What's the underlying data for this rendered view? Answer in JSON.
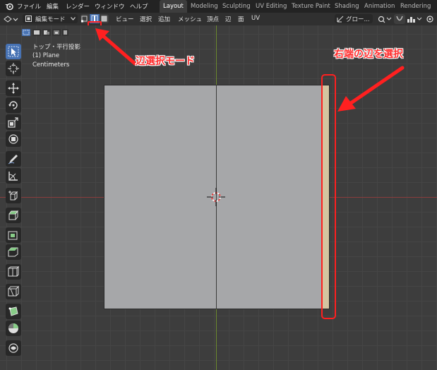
{
  "menubar": {
    "items": [
      "ファイル",
      "編集",
      "レンダー",
      "ウィンドウ",
      "ヘルプ"
    ],
    "workspaces": [
      "Layout",
      "Modeling",
      "Sculpting",
      "UV Editing",
      "Texture Paint",
      "Shading",
      "Animation",
      "Rendering"
    ],
    "active_workspace": "Layout"
  },
  "header": {
    "mode_label": "編集モード",
    "menus": [
      "ビュー",
      "選択",
      "追加",
      "メッシュ",
      "頂点",
      "辺",
      "面",
      "UV"
    ],
    "orientation_label": "グロー..."
  },
  "viewport": {
    "view_name": "トップ・平行投影",
    "object_name": "(1) Plane",
    "units": "Centimeters"
  },
  "annotations": {
    "edge_mode_label": "辺選択モード",
    "select_right_edge_label": "右端の辺を選択"
  },
  "colors": {
    "accent": "#4772b3",
    "annotation_red": "#ff2020",
    "mesh_face": "#a6a7a9",
    "x_axis": "#8a3d3d",
    "y_axis": "#6b8a2e",
    "selected_edge": "#d4c4a0"
  },
  "toolbar_icons": [
    "select-box-icon",
    "cursor-icon",
    "move-icon",
    "rotate-icon",
    "scale-icon",
    "transform-icon",
    "annotate-icon",
    "measure-icon",
    "add-cube-icon",
    "extrude-icon",
    "inset-icon",
    "bevel-icon",
    "loop-cut-icon",
    "knife-icon",
    "poly-build-icon",
    "spin-icon",
    "smooth-icon"
  ]
}
